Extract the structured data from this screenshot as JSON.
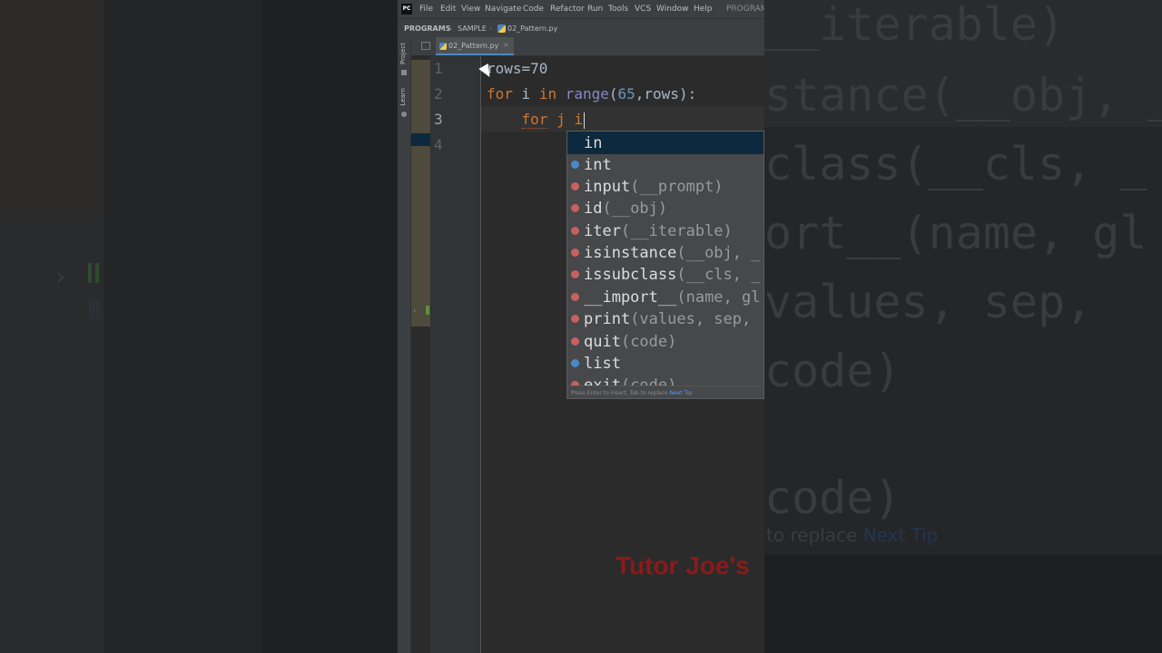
{
  "menubar": {
    "logo": "PC",
    "items": [
      "File",
      "Edit",
      "View",
      "Navigate",
      "Code",
      "Refactor",
      "Run",
      "Tools",
      "VCS",
      "Window",
      "Help"
    ],
    "project_truncated": "PROGRAM"
  },
  "breadcrumb": {
    "project": "PROGRAMS",
    "folder": "SAMPLE",
    "file": "02_Pattern.py"
  },
  "sidebar": {
    "project_label": "Project",
    "learn_label": "Learn"
  },
  "tab": {
    "label": "02_Pattern.py",
    "close": "×"
  },
  "editor": {
    "line_numbers": [
      "1",
      "2",
      "3",
      "4"
    ],
    "lines": {
      "l1": "rows=70",
      "l2_for": "for",
      "l2_i": " i ",
      "l2_in": "in",
      "l2_range": " range",
      "l2_open": "(",
      "l2_65": "65",
      "l2_rest": ",rows):",
      "l3_indent": "    ",
      "l3_for": "for",
      "l3_rest": " j i"
    }
  },
  "completion": {
    "items": [
      {
        "name": "in",
        "params": "",
        "icon": "none"
      },
      {
        "name": "int",
        "params": "",
        "icon": "class"
      },
      {
        "name": "input",
        "params": "(__prompt)",
        "icon": "function"
      },
      {
        "name": "id",
        "params": "(__obj)",
        "icon": "function"
      },
      {
        "name": "iter",
        "params": "(__iterable)",
        "icon": "function"
      },
      {
        "name": "isinstance",
        "params": "(__obj, _",
        "icon": "function"
      },
      {
        "name": "issubclass",
        "params": "(__cls, _",
        "icon": "function"
      },
      {
        "name": "__import__",
        "params": "(name, gl",
        "icon": "function"
      },
      {
        "name": "print",
        "params": "(values, sep,",
        "icon": "function"
      },
      {
        "name": "quit",
        "params": "(code)",
        "icon": "function"
      },
      {
        "name": "list",
        "params": "",
        "icon": "class"
      },
      {
        "name": "exit",
        "params": "(code)",
        "icon": "function"
      }
    ],
    "hint": "Press Enter to insert, Tab to replace",
    "next_tip": "Next Tip"
  },
  "background": {
    "code_lines": [
      "__iterable)",
      "stance(__obj, _",
      "class(__cls, _",
      "ort__(name, gl",
      "values, sep,",
      "code)",
      "code)"
    ],
    "tip": "to replace",
    "next_tip": "Next Tip"
  },
  "watermark": "Tutor Joe's",
  "colors": {
    "keyword": "#cc7832",
    "number": "#6897bb",
    "builtin": "#8888c6",
    "selection": "#0d293e",
    "watermark": "#8b1a1a"
  }
}
